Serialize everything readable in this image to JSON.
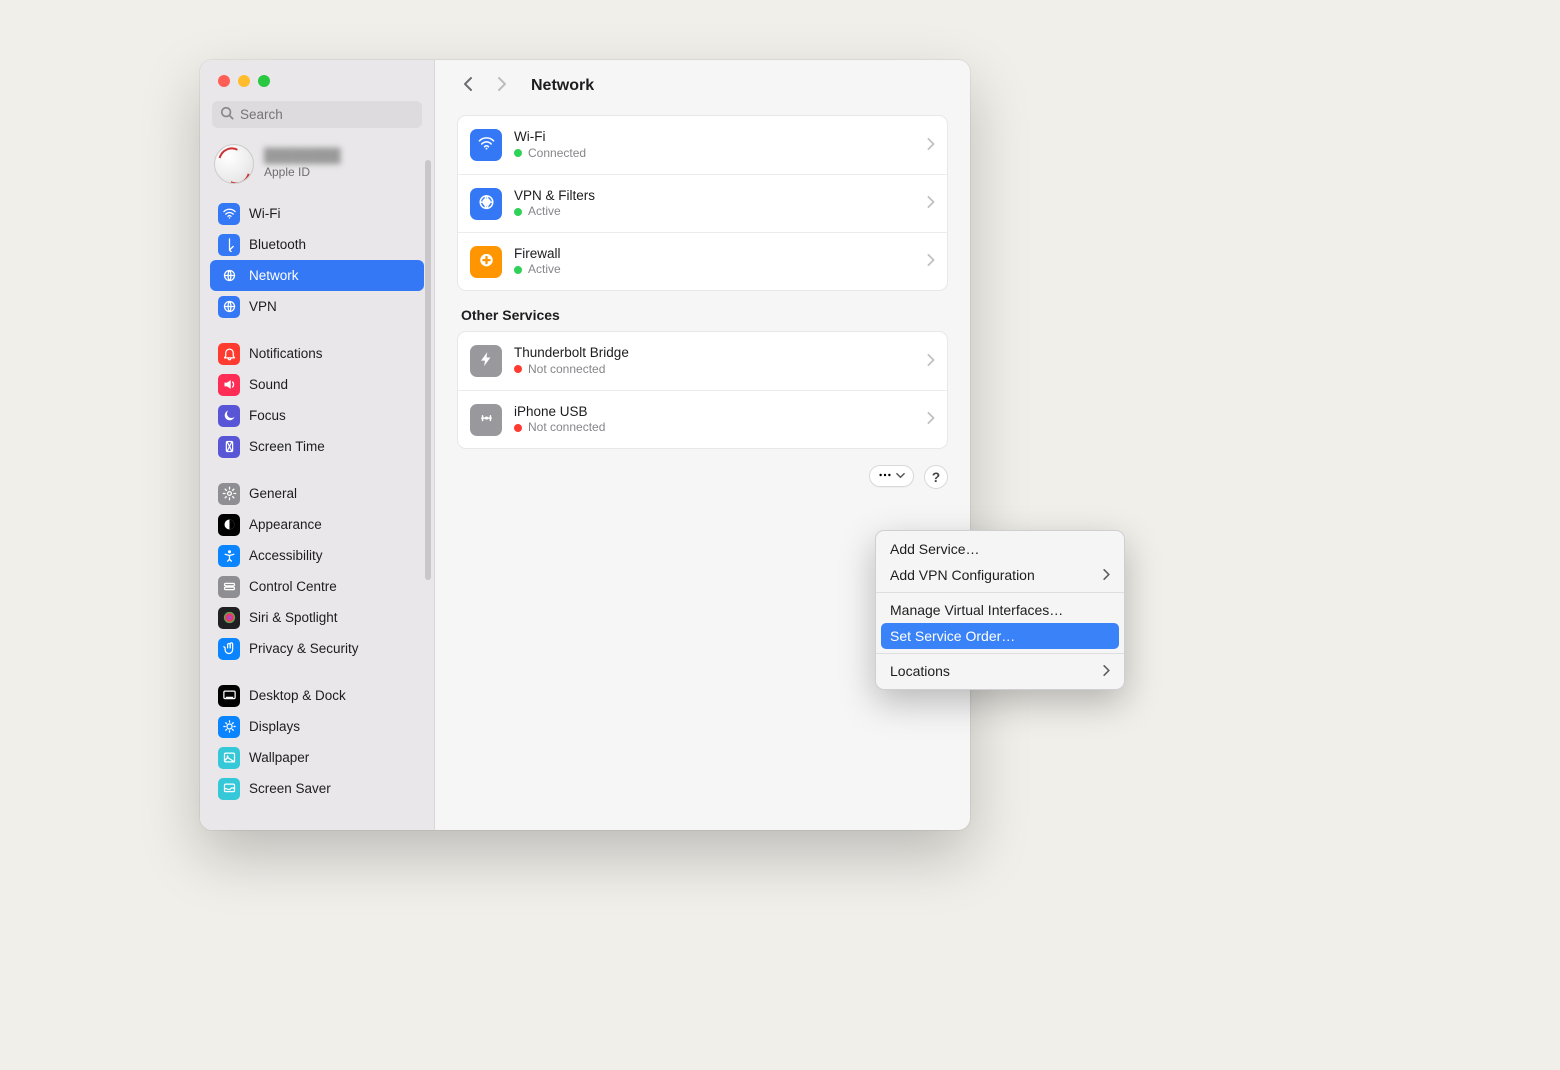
{
  "search": {
    "placeholder": "Search"
  },
  "apple_id": {
    "name": "████████",
    "sub": "Apple ID"
  },
  "sidebar": {
    "groups": [
      {
        "items": [
          {
            "label": "Wi-Fi",
            "color": "#3478f6",
            "glyph": "wifi"
          },
          {
            "label": "Bluetooth",
            "color": "#3478f6",
            "glyph": "bt"
          },
          {
            "label": "Network",
            "color": "#3478f6",
            "glyph": "globe",
            "selected": true
          },
          {
            "label": "VPN",
            "color": "#3478f6",
            "glyph": "globe"
          }
        ]
      },
      {
        "items": [
          {
            "label": "Notifications",
            "color": "#ff3b30",
            "glyph": "bell"
          },
          {
            "label": "Sound",
            "color": "#ff2d55",
            "glyph": "snd"
          },
          {
            "label": "Focus",
            "color": "#5856d6",
            "glyph": "moon"
          },
          {
            "label": "Screen Time",
            "color": "#5856d6",
            "glyph": "hour"
          }
        ]
      },
      {
        "items": [
          {
            "label": "General",
            "color": "#8e8e93",
            "glyph": "gear"
          },
          {
            "label": "Appearance",
            "color": "#000000",
            "glyph": "appr"
          },
          {
            "label": "Accessibility",
            "color": "#0a84ff",
            "glyph": "acc"
          },
          {
            "label": "Control Centre",
            "color": "#8e8e93",
            "glyph": "cc"
          },
          {
            "label": "Siri & Spotlight",
            "color": "#202022",
            "glyph": "siri"
          },
          {
            "label": "Privacy & Security",
            "color": "#0a84ff",
            "glyph": "hand"
          }
        ]
      },
      {
        "items": [
          {
            "label": "Desktop & Dock",
            "color": "#000000",
            "glyph": "dock"
          },
          {
            "label": "Displays",
            "color": "#0a84ff",
            "glyph": "disp"
          },
          {
            "label": "Wallpaper",
            "color": "#34c8d9",
            "glyph": "wall"
          },
          {
            "label": "Screen Saver",
            "color": "#34c8d9",
            "glyph": "scsv"
          }
        ]
      }
    ]
  },
  "header": {
    "title": "Network"
  },
  "main": {
    "primary": [
      {
        "title": "Wi-Fi",
        "status": "Connected",
        "status_kind": "green",
        "icon_color": "#3478f6",
        "glyph": "wifi"
      },
      {
        "title": "VPN & Filters",
        "status": "Active",
        "status_kind": "green",
        "icon_color": "#3478f6",
        "glyph": "vpnshield"
      },
      {
        "title": "Firewall",
        "status": "Active",
        "status_kind": "green",
        "icon_color": "#ff9500",
        "glyph": "firewall"
      }
    ],
    "other_title": "Other Services",
    "other": [
      {
        "title": "Thunderbolt Bridge",
        "status": "Not connected",
        "status_kind": "red",
        "icon_color": "#98989d",
        "glyph": "bolt"
      },
      {
        "title": "iPhone USB",
        "status": "Not connected",
        "status_kind": "red",
        "icon_color": "#98989d",
        "glyph": "usb"
      }
    ]
  },
  "popup": {
    "items": [
      {
        "label": "Add Service…"
      },
      {
        "label": "Add VPN Configuration",
        "submenu": true
      },
      {
        "sep": true
      },
      {
        "label": "Manage Virtual Interfaces…"
      },
      {
        "label": "Set Service Order…",
        "highlight": true
      },
      {
        "sep": true
      },
      {
        "label": "Locations",
        "submenu": true
      }
    ]
  },
  "help_glyph": "?"
}
